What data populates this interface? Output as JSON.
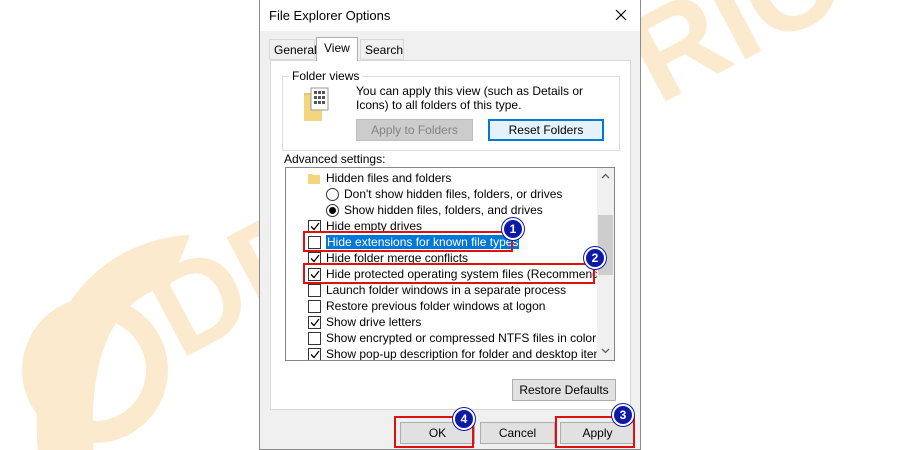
{
  "window": {
    "title": "File Explorer Options"
  },
  "tabs": [
    {
      "label": "General"
    },
    {
      "label": "View"
    },
    {
      "label": "Search"
    }
  ],
  "folder_views": {
    "group_title": "Folder views",
    "description": "You can apply this view (such as Details or Icons) to all folders of this type.",
    "apply_label": "Apply to Folders",
    "reset_label": "Reset Folders"
  },
  "advanced": {
    "label": "Advanced settings:",
    "items": [
      {
        "label": "Hidden files and folders",
        "kind": "folder"
      },
      {
        "label": "Don't show hidden files, folders, or drives",
        "kind": "radio",
        "checked": false
      },
      {
        "label": "Show hidden files, folders, and drives",
        "kind": "radio",
        "checked": true
      },
      {
        "label": "Hide empty drives",
        "kind": "checkbox",
        "checked": true
      },
      {
        "label": "Hide extensions for known file types",
        "kind": "checkbox",
        "checked": false,
        "selected": true
      },
      {
        "label": "Hide folder merge conflicts",
        "kind": "checkbox",
        "checked": true
      },
      {
        "label": "Hide protected operating system files (Recommended)",
        "kind": "checkbox",
        "checked": true
      },
      {
        "label": "Launch folder windows in a separate process",
        "kind": "checkbox",
        "checked": false
      },
      {
        "label": "Restore previous folder windows at logon",
        "kind": "checkbox",
        "checked": false
      },
      {
        "label": "Show drive letters",
        "kind": "checkbox",
        "checked": true
      },
      {
        "label": "Show encrypted or compressed NTFS files in color",
        "kind": "checkbox",
        "checked": false
      },
      {
        "label": "Show pop-up description for folder and desktop items",
        "kind": "checkbox",
        "checked": true
      }
    ],
    "restore_label": "Restore Defaults"
  },
  "footer": {
    "ok_label": "OK",
    "cancel_label": "Cancel",
    "apply_label": "Apply"
  },
  "annotations": {
    "badges": [
      "1",
      "2",
      "3",
      "4"
    ],
    "highlight_color": "#e01010",
    "badge_color": "#0d1aa8"
  },
  "watermark": {
    "text": "DEVICETRICKS",
    "color": "#f6dcae"
  },
  "icons": {
    "close": "close-icon",
    "folder_views": "folder-views-icon",
    "folder": "folder-icon",
    "scroll_up": "chevron-up-icon",
    "scroll_down": "chevron-down-icon"
  }
}
